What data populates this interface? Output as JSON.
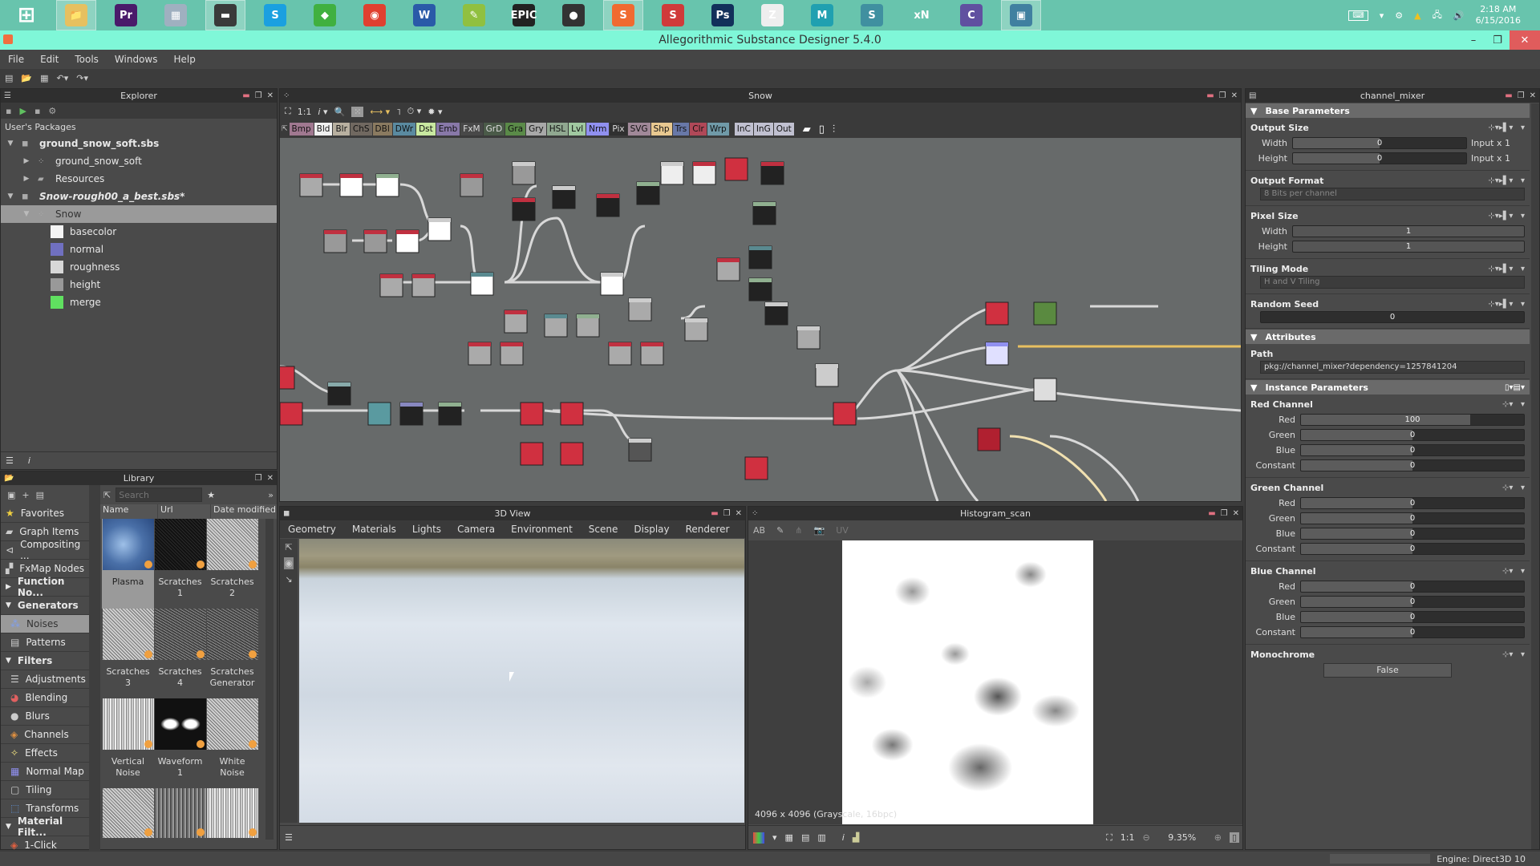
{
  "taskbar": {
    "apps": [
      {
        "name": "windows-start",
        "glyph": "⊞",
        "color": "#ffffff",
        "active": false
      },
      {
        "name": "file-explorer",
        "glyph": "📁",
        "color": "#e6c060",
        "active": true
      },
      {
        "name": "premiere-pro",
        "glyph": "Pr",
        "color": "#4a1a6a",
        "active": false
      },
      {
        "name": "calculator",
        "glyph": "▦",
        "color": "#9fb0c0",
        "active": false
      },
      {
        "name": "media-app",
        "glyph": "▬",
        "color": "#3a3a3a",
        "active": true
      },
      {
        "name": "skype",
        "glyph": "S",
        "color": "#1aa0e0",
        "active": false
      },
      {
        "name": "green-app",
        "glyph": "◆",
        "color": "#40b040",
        "active": false
      },
      {
        "name": "chrome",
        "glyph": "◉",
        "color": "#e04030",
        "active": false
      },
      {
        "name": "word",
        "glyph": "W",
        "color": "#2a5aa8",
        "active": false
      },
      {
        "name": "notepad-plus-plus",
        "glyph": "✎",
        "color": "#90c040",
        "active": false
      },
      {
        "name": "epic-games",
        "glyph": "EPIC",
        "color": "#222222",
        "active": false
      },
      {
        "name": "monkey-app",
        "glyph": "●",
        "color": "#333333",
        "active": false
      },
      {
        "name": "substance-designer",
        "glyph": "S",
        "color": "#f06a30",
        "active": true
      },
      {
        "name": "substance-painter",
        "glyph": "S",
        "color": "#d03a3a",
        "active": false
      },
      {
        "name": "photoshop",
        "glyph": "Ps",
        "color": "#12305a",
        "active": false
      },
      {
        "name": "zbrush",
        "glyph": "Z",
        "color": "#eeeeee",
        "active": false
      },
      {
        "name": "maya",
        "glyph": "M",
        "color": "#20a0b0",
        "active": false
      },
      {
        "name": "substance-share",
        "glyph": "S",
        "color": "#4090a0",
        "active": false
      },
      {
        "name": "xnormal",
        "glyph": "xN",
        "color": "#68c4ad",
        "active": false
      },
      {
        "name": "clip-app",
        "glyph": "C",
        "color": "#6050a0",
        "active": false
      },
      {
        "name": "photo-viewer",
        "glyph": "▣",
        "color": "#4080a0",
        "active": true
      }
    ],
    "tray": {
      "time": "2:18 AM",
      "date": "6/15/2016"
    }
  },
  "window": {
    "title": "Allegorithmic Substance Designer 5.4.0",
    "minimize": "–",
    "restore": "❐",
    "close": "✕"
  },
  "menu": [
    "File",
    "Edit",
    "Tools",
    "Windows",
    "Help"
  ],
  "explorer": {
    "title": "Explorer",
    "section": "User's Packages",
    "tree": [
      {
        "label": "ground_snow_soft.sbs",
        "level": 0,
        "arrow": "▼",
        "bold": true,
        "italic": false,
        "icon": "package-icon"
      },
      {
        "label": "ground_snow_soft",
        "level": 1,
        "arrow": "▶",
        "bold": false,
        "italic": false,
        "icon": "graph-icon"
      },
      {
        "label": "Resources",
        "level": 1,
        "arrow": "▶",
        "bold": false,
        "italic": false,
        "icon": "folder-icon"
      },
      {
        "label": "Snow-rough00_a_best.sbs*",
        "level": 0,
        "arrow": "▼",
        "bold": true,
        "italic": true,
        "icon": "package-icon"
      },
      {
        "label": "Snow",
        "level": 1,
        "arrow": "▼",
        "bold": false,
        "italic": false,
        "icon": "graph-icon",
        "selected": true
      },
      {
        "label": "basecolor",
        "level": 2,
        "swatch": "#f4f4f4"
      },
      {
        "label": "normal",
        "level": 2,
        "swatch": "#7070c0"
      },
      {
        "label": "roughness",
        "level": 2,
        "swatch": "#d8d8d8"
      },
      {
        "label": "height",
        "level": 2,
        "swatch": "#999999"
      },
      {
        "label": "merge",
        "level": 2,
        "swatch": "#60e060"
      }
    ]
  },
  "library": {
    "title": "Library",
    "search_placeholder": "Search",
    "columns": [
      "Name",
      "Url",
      "Date modified"
    ],
    "categories": [
      {
        "label": "Favorites",
        "icon": "star-icon",
        "bold": false
      },
      {
        "label": "Graph Items",
        "icon": "comment-icon",
        "bold": false
      },
      {
        "label": "Compositing ...",
        "icon": "compositing-icon",
        "bold": false
      },
      {
        "label": "FxMap Nodes",
        "icon": "fxmap-icon",
        "bold": false
      },
      {
        "label": "Function No...",
        "icon": "arrow-right",
        "bold": true,
        "arrow": "▶"
      },
      {
        "label": "Generators",
        "icon": "arrow-down",
        "bold": true,
        "arrow": "▼"
      },
      {
        "label": "Noises",
        "icon": "noise-icon",
        "bold": false,
        "selected": true,
        "indent": true
      },
      {
        "label": "Patterns",
        "icon": "pattern-icon",
        "bold": false,
        "indent": true
      },
      {
        "label": "Filters",
        "icon": "arrow-down",
        "bold": true,
        "arrow": "▼"
      },
      {
        "label": "Adjustments",
        "icon": "adjustments-icon",
        "bold": false,
        "indent": true
      },
      {
        "label": "Blending",
        "icon": "blending-icon",
        "bold": false,
        "indent": true
      },
      {
        "label": "Blurs",
        "icon": "blur-icon",
        "bold": false,
        "indent": true
      },
      {
        "label": "Channels",
        "icon": "channels-icon",
        "bold": false,
        "indent": true
      },
      {
        "label": "Effects",
        "icon": "effects-icon",
        "bold": false,
        "indent": true
      },
      {
        "label": "Normal Map",
        "icon": "normal-map-icon",
        "bold": false,
        "indent": true
      },
      {
        "label": "Tiling",
        "icon": "tiling-icon",
        "bold": false,
        "indent": true
      },
      {
        "label": "Transforms",
        "icon": "transforms-icon",
        "bold": false,
        "indent": true
      },
      {
        "label": "Material Filt...",
        "icon": "arrow-down",
        "bold": true,
        "arrow": "▼"
      },
      {
        "label": "1-Click",
        "icon": "one-click-icon",
        "bold": false,
        "indent": true
      }
    ],
    "items": [
      {
        "label": "Plasma",
        "style": "plasma",
        "selected": true
      },
      {
        "label": "Scratches\n1",
        "style": "dark"
      },
      {
        "label": "Scratches\n2",
        "style": "noise"
      },
      {
        "label": "Scratches\n3",
        "style": "noise"
      },
      {
        "label": "Scratches\n4",
        "style": "noise-dark"
      },
      {
        "label": "Scratches\nGenerator",
        "style": "noise-dark"
      },
      {
        "label": "Vertical\nNoise",
        "style": "vertical"
      },
      {
        "label": "Waveform\n1",
        "style": "waveform"
      },
      {
        "label": "White\nNoise",
        "style": "noise"
      },
      {
        "label": "",
        "style": "noise"
      },
      {
        "label": "",
        "style": "vertical-dark"
      },
      {
        "label": "",
        "style": "vertical"
      }
    ]
  },
  "graph": {
    "title": "Snow",
    "zoom_label": "1:1",
    "atomic_nodes": [
      {
        "label": "Bmp",
        "color": "#a07890"
      },
      {
        "label": "Bld",
        "color": "#f0f0f0"
      },
      {
        "label": "Blr",
        "color": "#b8b0a0"
      },
      {
        "label": "ChS",
        "color": "#706860"
      },
      {
        "label": "DBl",
        "color": "#8a7a60"
      },
      {
        "label": "DWr",
        "color": "#5a8aa0"
      },
      {
        "label": "Dst",
        "color": "#c8e8a0"
      },
      {
        "label": "Emb",
        "color": "#8878a8"
      },
      {
        "label": "FxM",
        "color": "#484848"
      },
      {
        "label": "GrD",
        "color": "#4a5a48"
      },
      {
        "label": "Gra",
        "color": "#5a8a48"
      },
      {
        "label": "Gry",
        "color": "#a8a8a8"
      },
      {
        "label": "HSL",
        "color": "#90a890"
      },
      {
        "label": "Lvl",
        "color": "#a0c8a0"
      },
      {
        "label": "Nrm",
        "color": "#9090f0"
      },
      {
        "label": "Pix",
        "color": "#303030"
      },
      {
        "label": "SVG",
        "color": "#a08898"
      },
      {
        "label": "Shp",
        "color": "#e8c890"
      },
      {
        "label": "Trs",
        "color": "#6878a8"
      },
      {
        "label": "Clr",
        "color": "#b04858"
      },
      {
        "label": "Wrp",
        "color": "#709aa8"
      },
      {
        "label": "InC",
        "color": "#c0c0d0"
      },
      {
        "label": "InG",
        "color": "#c0c0d0"
      },
      {
        "label": "Out",
        "color": "#c0c0d0"
      }
    ]
  },
  "view3d": {
    "title": "3D View",
    "menu": [
      "Geometry",
      "Materials",
      "Lights",
      "Camera",
      "Environment",
      "Scene",
      "Display",
      "Renderer"
    ]
  },
  "view2d": {
    "title": "Histogram_scan",
    "uv_label": "UV",
    "info": "4096 x 4096 (Grayscale, 16bpc)",
    "ratio_label": "1:1",
    "zoom": "9.35%"
  },
  "properties": {
    "title": "channel_mixer",
    "base_section": "Base Parameters",
    "output_size": {
      "title": "Output Size",
      "width_label": "Width",
      "width_value": "0",
      "width_fill": 0.5,
      "width_suffix": "Input x 1",
      "height_label": "Height",
      "height_value": "0",
      "height_fill": 0.5,
      "height_suffix": "Input x 1"
    },
    "output_format": {
      "title": "Output Format",
      "value": "8 Bits per channel"
    },
    "pixel_size": {
      "title": "Pixel Size",
      "width_label": "Width",
      "width_value": "1",
      "height_label": "Height",
      "height_value": "1"
    },
    "tiling_mode": {
      "title": "Tiling Mode",
      "value": "H and V Tiling"
    },
    "random_seed": {
      "title": "Random Seed",
      "value": "0"
    },
    "attributes_section": "Attributes",
    "path_label": "Path",
    "path_value": "pkg://channel_mixer?dependency=1257841204",
    "instance_section": "Instance Parameters",
    "channels": [
      {
        "title": "Red Channel",
        "rows": [
          {
            "label": "Red",
            "value": "100",
            "fill": 1.0
          },
          {
            "label": "Green",
            "value": "0",
            "fill": 0.5
          },
          {
            "label": "Blue",
            "value": "0",
            "fill": 0.5
          },
          {
            "label": "Constant",
            "value": "0",
            "fill": 0.5
          }
        ]
      },
      {
        "title": "Green Channel",
        "rows": [
          {
            "label": "Red",
            "value": "0",
            "fill": 0.5
          },
          {
            "label": "Green",
            "value": "0",
            "fill": 0.5
          },
          {
            "label": "Blue",
            "value": "0",
            "fill": 0.5
          },
          {
            "label": "Constant",
            "value": "0",
            "fill": 0.5
          }
        ]
      },
      {
        "title": "Blue Channel",
        "rows": [
          {
            "label": "Red",
            "value": "0",
            "fill": 0.5
          },
          {
            "label": "Green",
            "value": "0",
            "fill": 0.5
          },
          {
            "label": "Blue",
            "value": "0",
            "fill": 0.5
          },
          {
            "label": "Constant",
            "value": "0",
            "fill": 0.5
          }
        ]
      }
    ],
    "monochrome": {
      "title": "Monochrome",
      "value": "False"
    }
  },
  "status": {
    "engine": "Engine: Direct3D 10"
  }
}
